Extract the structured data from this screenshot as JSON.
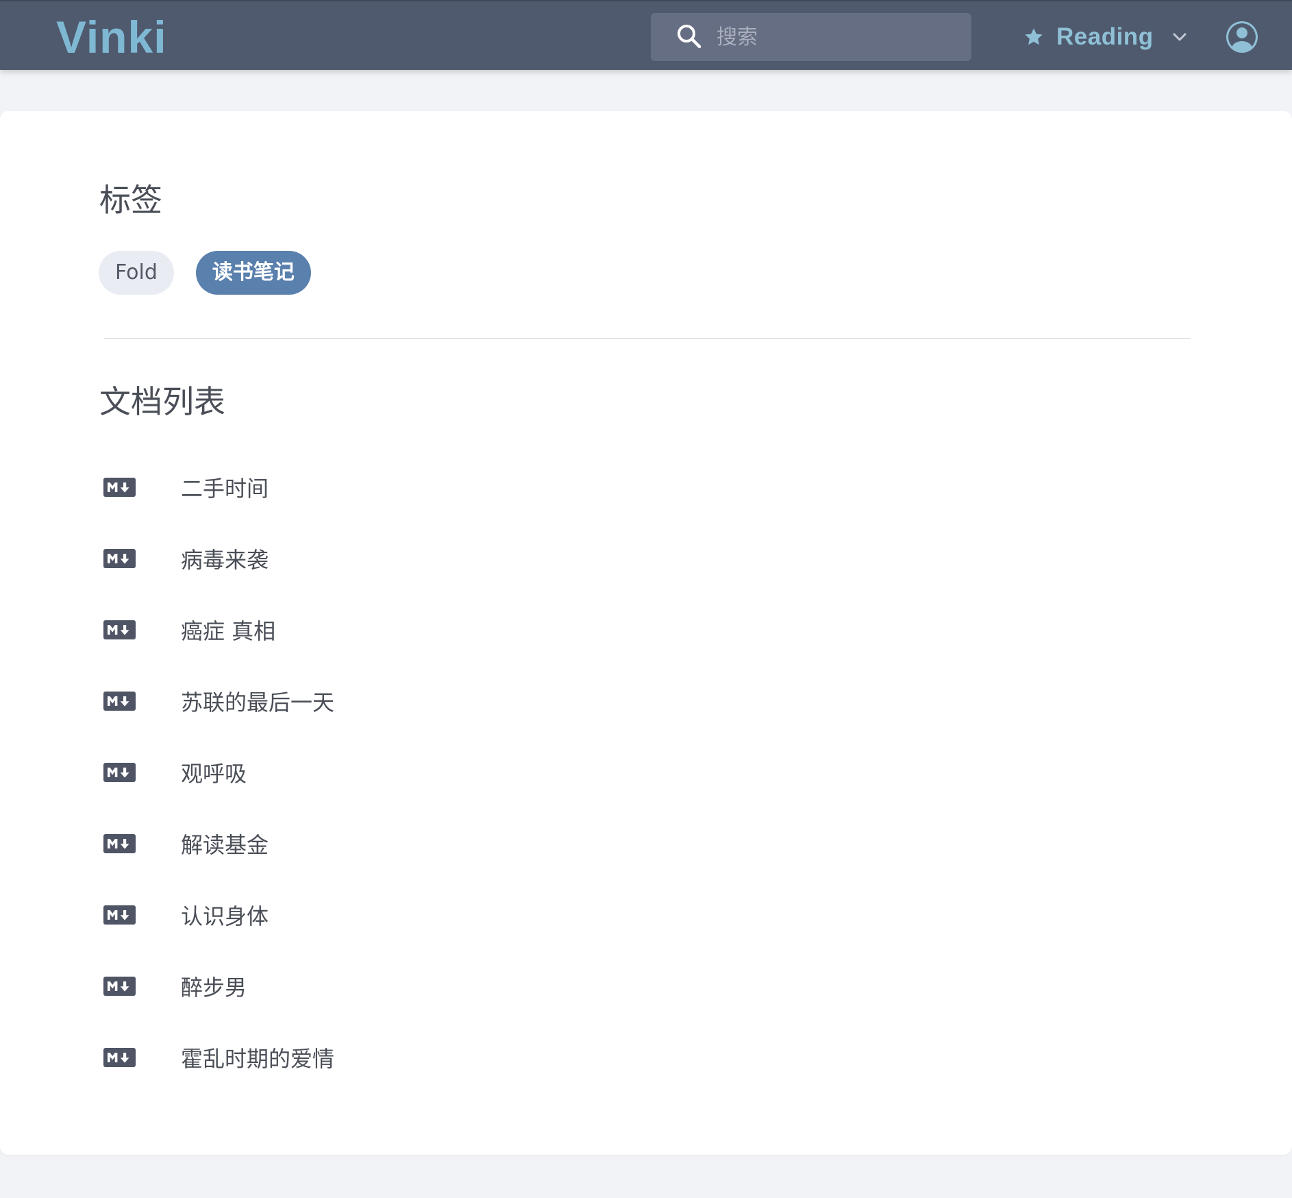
{
  "app": {
    "name": "Vinki"
  },
  "header": {
    "search": {
      "placeholder": "搜索",
      "value": ""
    },
    "space": {
      "label": "Reading",
      "icon": "star-icon"
    },
    "avatar_icon": "user-circle-icon"
  },
  "tags_section": {
    "title": "标签",
    "tags": [
      {
        "label": "Fold",
        "active": false
      },
      {
        "label": "读书笔记",
        "active": true
      }
    ]
  },
  "docs_section": {
    "title": "文档列表",
    "doc_icon": "markdown-icon",
    "docs": [
      {
        "title": "二手时间"
      },
      {
        "title": "病毒来袭"
      },
      {
        "title": "癌症 真相"
      },
      {
        "title": "苏联的最后一天"
      },
      {
        "title": "观呼吸"
      },
      {
        "title": "解读基金"
      },
      {
        "title": "认识身体"
      },
      {
        "title": "醉步男"
      },
      {
        "title": "霍乱时期的爱情"
      }
    ]
  },
  "colors": {
    "topbar": "#4f5a6e",
    "brand": "#7fb8d3",
    "accent": "#5a80ad",
    "page_bg": "#f2f3f7"
  }
}
